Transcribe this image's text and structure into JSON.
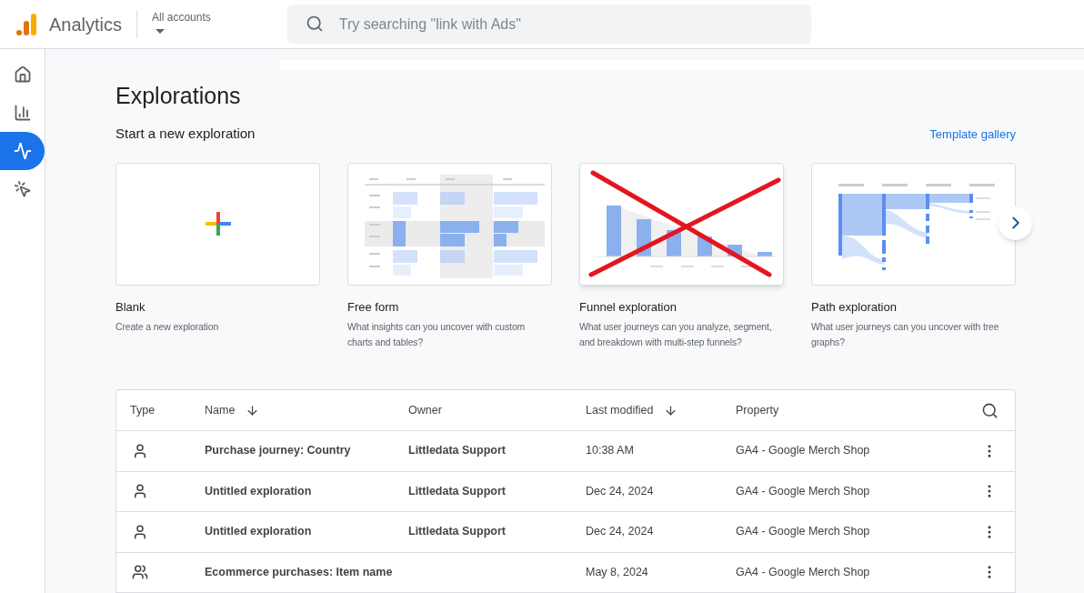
{
  "header": {
    "product": "Analytics",
    "account_label": "All accounts",
    "search": {
      "placeholder": "Try searching \"link with Ads\""
    }
  },
  "sidebar": {
    "items": [
      {
        "kind": "home",
        "selected": false
      },
      {
        "kind": "reports",
        "selected": false
      },
      {
        "kind": "explore",
        "selected": true
      },
      {
        "kind": "advertising",
        "selected": false
      }
    ]
  },
  "page": {
    "title": "Explorations",
    "section_title": "Start a new exploration",
    "template_gallery": "Template gallery"
  },
  "templates": [
    {
      "kind": "blank",
      "title": "Blank",
      "description": "Create a new exploration",
      "crossed_out": false
    },
    {
      "kind": "freeform",
      "title": "Free form",
      "description": "What insights can you uncover with custom charts and tables?",
      "crossed_out": false
    },
    {
      "kind": "funnel",
      "title": "Funnel exploration",
      "description": "What user journeys can you analyze, segment, and breakdown with multi-step funnels?",
      "crossed_out": true
    },
    {
      "kind": "path",
      "title": "Path exploration",
      "description": "What user journeys can you uncover with tree graphs?",
      "crossed_out": false
    }
  ],
  "table": {
    "columns": [
      {
        "label": "Type",
        "sorted": false
      },
      {
        "label": "Name",
        "sorted": true
      },
      {
        "label": "Owner",
        "sorted": false
      },
      {
        "label": "Last modified",
        "sorted": true
      },
      {
        "label": "Property",
        "sorted": false
      }
    ],
    "rows": [
      {
        "kind": "single",
        "name": "Purchase journey: Country",
        "owner": "Littledata Support",
        "last_modified": "10:38 AM",
        "property": "GA4 - Google Merch Shop"
      },
      {
        "kind": "single",
        "name": "Untitled exploration",
        "owner": "Littledata Support",
        "last_modified": "Dec 24, 2024",
        "property": "GA4 - Google Merch Shop"
      },
      {
        "kind": "single",
        "name": "Untitled exploration",
        "owner": "Littledata Support",
        "last_modified": "Dec 24, 2024",
        "property": "GA4 - Google Merch Shop"
      },
      {
        "kind": "shared",
        "name": "Ecommerce purchases: Item name",
        "owner": "",
        "last_modified": "May 8, 2024",
        "property": "GA4 - Google Merch Shop"
      }
    ]
  }
}
